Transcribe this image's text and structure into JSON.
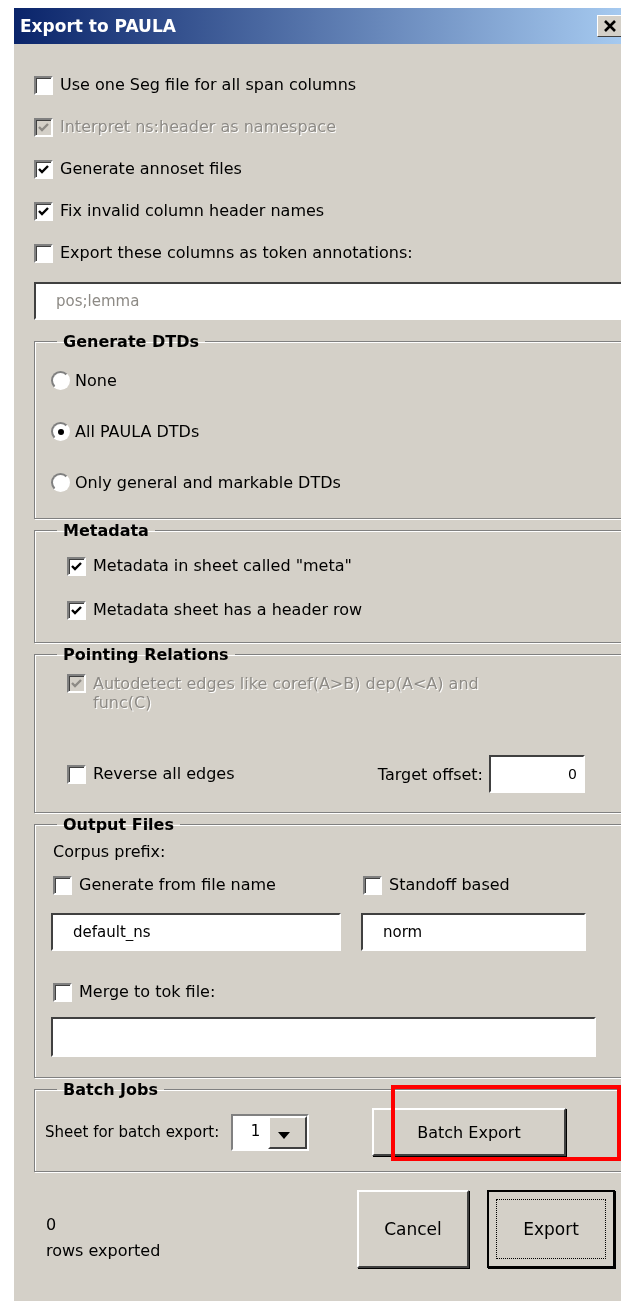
{
  "window": {
    "title": "Export to PAULA"
  },
  "options": [
    {
      "label": "Use one Seg file for all span columns",
      "checked": false,
      "disabled": false
    },
    {
      "label": "Interpret ns:header as namespace",
      "checked": true,
      "disabled": true
    },
    {
      "label": "Generate annoset files",
      "checked": true,
      "disabled": false
    },
    {
      "label": "Fix invalid column header names",
      "checked": true,
      "disabled": false
    },
    {
      "label": "Export these columns as token annotations:",
      "checked": false,
      "disabled": false
    }
  ],
  "token_columns": {
    "placeholder": "pos;lemma"
  },
  "generate_dtds": {
    "title": "Generate DTDs",
    "options": [
      {
        "label": "None",
        "selected": false
      },
      {
        "label": "All PAULA DTDs",
        "selected": true
      },
      {
        "label": "Only general and markable DTDs",
        "selected": false
      }
    ]
  },
  "metadata": {
    "title": "Metadata",
    "options": [
      {
        "label": "Metadata in sheet called \"meta\"",
        "checked": true,
        "disabled": false
      },
      {
        "label": "Metadata sheet has a header row",
        "checked": true,
        "disabled": false
      }
    ]
  },
  "pointing_relations": {
    "title": "Pointing Relations",
    "autodetect": {
      "label": "Autodetect edges like coref(A>B) dep(A<A) and func(C)",
      "checked": true,
      "disabled": true
    },
    "reverse": {
      "label": "Reverse all edges",
      "checked": false,
      "disabled": false
    },
    "target_offset": {
      "label": "Target offset:",
      "value": "0"
    }
  },
  "output_files": {
    "title": "Output Files",
    "corpus_prefix_label": "Corpus prefix:",
    "generate_from_file_name": {
      "label": "Generate from file name",
      "checked": false,
      "disabled": false
    },
    "standoff_based": {
      "label": "Standoff based",
      "checked": false,
      "disabled": false
    },
    "prefix_value": "default_ns",
    "standoff_value": "norm",
    "merge": {
      "label": "Merge to tok file:",
      "checked": false,
      "disabled": false
    }
  },
  "batch_jobs": {
    "title": "Batch Jobs",
    "sheet_label": "Sheet for batch export:",
    "sheet_value": "1",
    "button": {
      "label": "Batch Export",
      "highlighted": true
    }
  },
  "status": {
    "count": "0",
    "label": "rows exported"
  },
  "buttons": [
    {
      "label": "Cancel",
      "default": false
    },
    {
      "label": "Export",
      "default": true
    }
  ]
}
